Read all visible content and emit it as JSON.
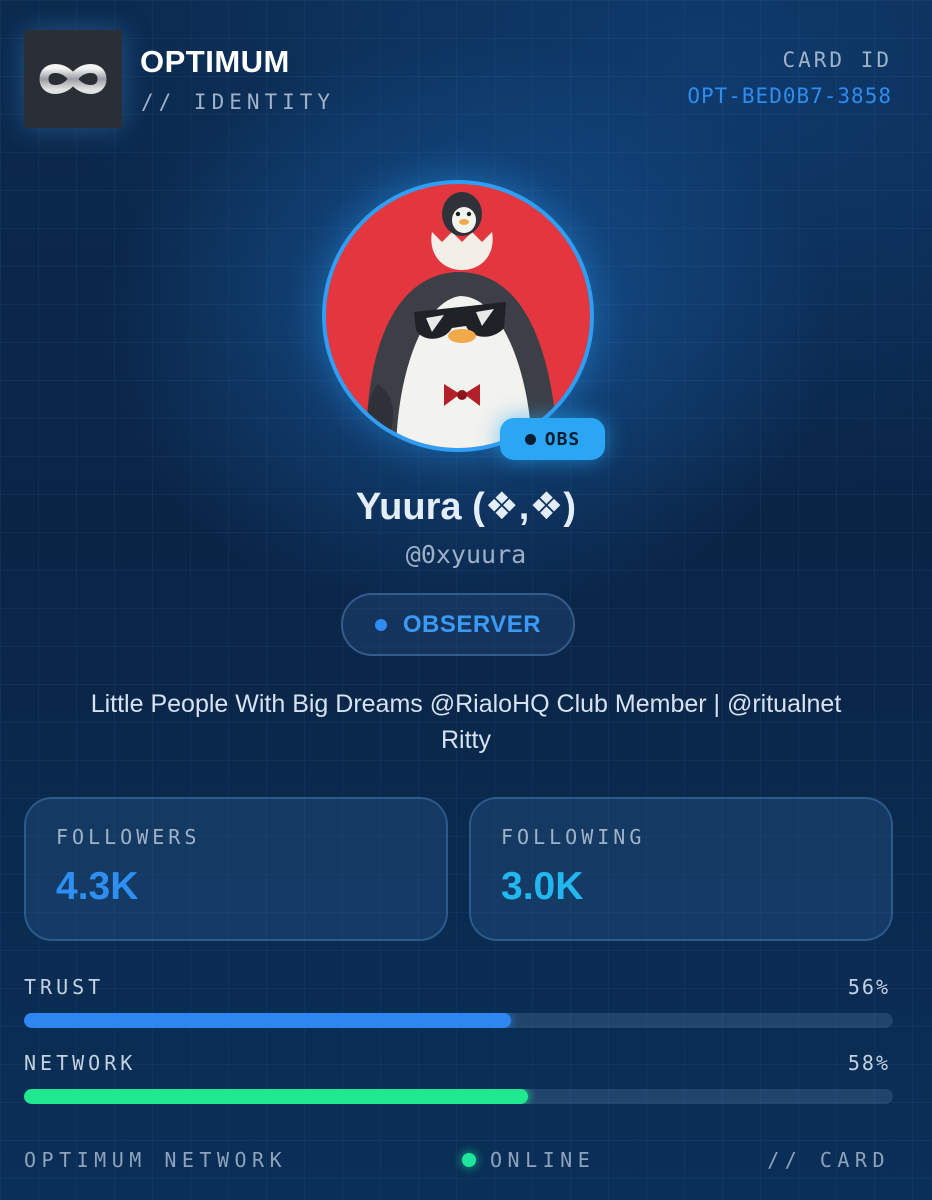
{
  "header": {
    "brand_title": "OPTIMUM",
    "brand_subtitle": "// IDENTITY",
    "card_id_label": "CARD ID",
    "card_id_value": "OPT-BED0B7-3858",
    "logo_icon": "infinity-icon"
  },
  "profile": {
    "avatar_icon": "penguin-avatar",
    "badge_text": "OBS",
    "display_name": "Yuura (❖,❖)",
    "handle": "@0xyuura",
    "role_label": "OBSERVER",
    "bio": "Little People With Big Dreams @RialoHQ Club Member | @ritualnet Ritty"
  },
  "stats": [
    {
      "label": "FOLLOWERS",
      "value": "4.3K",
      "color": "#2f8ff0"
    },
    {
      "label": "FOLLOWING",
      "value": "3.0K",
      "color": "#22b8ef"
    }
  ],
  "meters": [
    {
      "label": "TRUST",
      "percent_text": "56%",
      "fraction": 0.56,
      "color": "#2e86f0"
    },
    {
      "label": "NETWORK",
      "percent_text": "58%",
      "fraction": 0.58,
      "color": "#1fe88f"
    }
  ],
  "footer": {
    "left_text": "OPTIMUM NETWORK",
    "status_text": "ONLINE",
    "right_text": "// CARD"
  },
  "colors": {
    "accent_blue": "#2d8df0",
    "online_green": "#1ee69a",
    "avatar_bg": "#e4363f"
  }
}
